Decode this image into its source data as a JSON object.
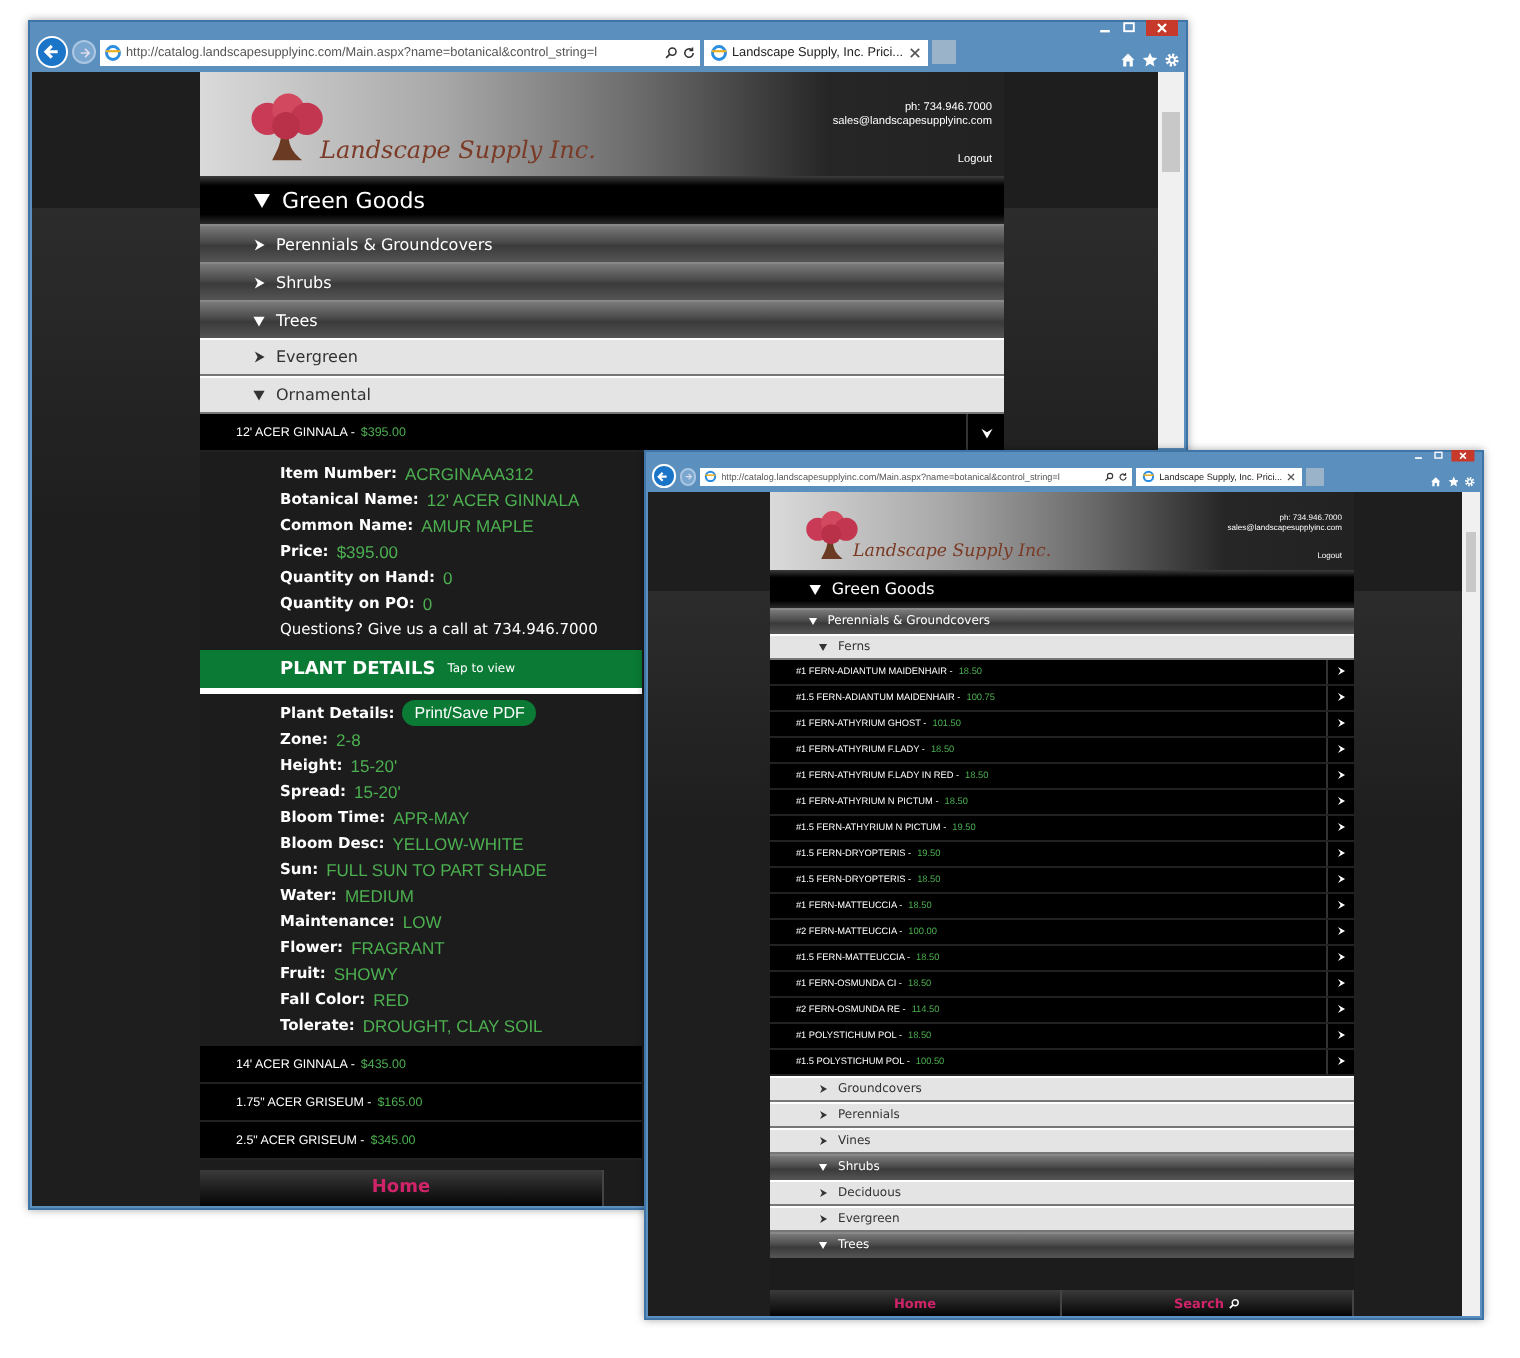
{
  "windows": [
    {
      "browser": {
        "url": "http://catalog.landscapesupplyinc.com/Main.aspx?name=botanical&control_string=l",
        "tab_title": "Landscape Supply, Inc. Prici..."
      },
      "header": {
        "logo_text": "Landscape Supply Inc.",
        "phone": "ph: 734.946.7000",
        "email": "sales@landscapesupplyinc.com",
        "logout": "Logout"
      },
      "rows": [
        {
          "kind": "top",
          "label": "Green Goods",
          "expanded": true
        },
        {
          "kind": "group",
          "label": "Perennials & Groundcovers",
          "expanded": false
        },
        {
          "kind": "group",
          "label": "Shrubs",
          "expanded": false
        },
        {
          "kind": "group",
          "label": "Trees",
          "expanded": true
        },
        {
          "kind": "sub",
          "label": "Evergreen",
          "expanded": false
        },
        {
          "kind": "sub",
          "label": "Ornamental",
          "expanded": true
        },
        {
          "kind": "product",
          "name": "12' ACER GINNALA -",
          "price": "$395.00",
          "expanded": true
        },
        {
          "kind": "info",
          "fields": [
            {
              "label": "Item Number:",
              "value": "ACRGINAAA312"
            },
            {
              "label": "Botanical Name:",
              "value": "12' ACER GINNALA"
            },
            {
              "label": "Common Name:",
              "value": "AMUR MAPLE"
            },
            {
              "label": "Price:",
              "value": "$395.00"
            },
            {
              "label": "Quantity on Hand:",
              "value": "0"
            },
            {
              "label": "Quantity on PO:",
              "value": "0"
            }
          ],
          "note": "Questions? Give us a call at 734.946.7000"
        },
        {
          "kind": "banner",
          "title": "PLANT DETAILS",
          "hint": "Tap to view"
        },
        {
          "kind": "specs",
          "label": "Plant Details:",
          "button": "Print/Save PDF",
          "fields": [
            {
              "label": "Zone:",
              "value": "2-8"
            },
            {
              "label": "Height:",
              "value": "15-20'"
            },
            {
              "label": "Spread:",
              "value": "15-20'"
            },
            {
              "label": "Bloom Time:",
              "value": "APR-MAY"
            },
            {
              "label": "Bloom Desc:",
              "value": "YELLOW-WHITE"
            },
            {
              "label": "Sun:",
              "value": "FULL SUN TO PART SHADE"
            },
            {
              "label": "Water:",
              "value": "MEDIUM"
            },
            {
              "label": "Maintenance:",
              "value": "LOW"
            },
            {
              "label": "Flower:",
              "value": "FRAGRANT"
            },
            {
              "label": "Fruit:",
              "value": "SHOWY"
            },
            {
              "label": "Fall Color:",
              "value": "RED"
            },
            {
              "label": "Tolerate:",
              "value": "DROUGHT, CLAY SOIL"
            }
          ]
        },
        {
          "kind": "product",
          "name": "14' ACER GINNALA -",
          "price": "$435.00"
        },
        {
          "kind": "product",
          "name": "1.75\" ACER GRISEUM -",
          "price": "$165.00"
        },
        {
          "kind": "product",
          "name": "2.5\" ACER GRISEUM -",
          "price": "$345.00"
        }
      ],
      "footer": [
        "Home"
      ]
    },
    {
      "browser": {
        "url": "http://catalog.landscapesupplyinc.com/Main.aspx?name=botanical&control_string=l",
        "tab_title": "Landscape Supply, Inc. Prici..."
      },
      "header": {
        "logo_text": "Landscape Supply Inc.",
        "phone": "ph: 734.946.7000",
        "email": "sales@landscapesupplyinc.com",
        "logout": "Logout"
      },
      "rows": [
        {
          "kind": "top",
          "label": "Green Goods",
          "expanded": true
        },
        {
          "kind": "group",
          "label": "Perennials & Groundcovers",
          "expanded": true
        },
        {
          "kind": "sub",
          "label": "Ferns",
          "expanded": true
        },
        {
          "kind": "product",
          "name": "#1 FERN-ADIANTUM MAIDENHAIR -",
          "price": "18.50",
          "expanded": false
        },
        {
          "kind": "product",
          "name": "#1.5 FERN-ADIANTUM MAIDENHAIR -",
          "price": "100.75",
          "expanded": false
        },
        {
          "kind": "product",
          "name": "#1 FERN-ATHYRIUM GHOST -",
          "price": "101.50",
          "expanded": false
        },
        {
          "kind": "product",
          "name": "#1 FERN-ATHYRIUM F.LADY -",
          "price": "18.50",
          "expanded": false
        },
        {
          "kind": "product",
          "name": "#1 FERN-ATHYRIUM F.LADY IN RED -",
          "price": "18.50",
          "expanded": false
        },
        {
          "kind": "product",
          "name": "#1 FERN-ATHYRIUM N PICTUM -",
          "price": "18.50",
          "expanded": false
        },
        {
          "kind": "product",
          "name": "#1.5 FERN-ATHYRIUM N PICTUM -",
          "price": "19.50",
          "expanded": false
        },
        {
          "kind": "product",
          "name": "#1.5 FERN-DRYOPTERIS -",
          "price": "19.50",
          "expanded": false
        },
        {
          "kind": "product",
          "name": "#1.5 FERN-DRYOPTERIS -",
          "price": "18.50",
          "expanded": false
        },
        {
          "kind": "product",
          "name": "#1 FERN-MATTEUCCIA -",
          "price": "18.50",
          "expanded": false
        },
        {
          "kind": "product",
          "name": "#2 FERN-MATTEUCCIA -",
          "price": "100.00",
          "expanded": false
        },
        {
          "kind": "product",
          "name": "#1.5 FERN-MATTEUCCIA -",
          "price": "18.50",
          "expanded": false
        },
        {
          "kind": "product",
          "name": "#1 FERN-OSMUNDA CI -",
          "price": "18.50",
          "expanded": false
        },
        {
          "kind": "product",
          "name": "#2 FERN-OSMUNDA RE -",
          "price": "114.50",
          "expanded": false
        },
        {
          "kind": "product",
          "name": "#1 POLYSTICHUM POL -",
          "price": "18.50",
          "expanded": false
        },
        {
          "kind": "product",
          "name": "#1.5 POLYSTICHUM POL -",
          "price": "100.50",
          "expanded": false
        },
        {
          "kind": "sub",
          "label": "Groundcovers",
          "expanded": false
        },
        {
          "kind": "sub",
          "label": "Perennials",
          "expanded": false
        },
        {
          "kind": "sub",
          "label": "Vines",
          "expanded": false
        },
        {
          "kind": "group",
          "label": "Shrubs",
          "expanded": true
        },
        {
          "kind": "sub",
          "label": "Deciduous",
          "expanded": false
        },
        {
          "kind": "sub",
          "label": "Evergreen",
          "expanded": false
        },
        {
          "kind": "group",
          "label": "Trees",
          "expanded": true
        }
      ],
      "footer": [
        "Home",
        "Search"
      ]
    }
  ]
}
